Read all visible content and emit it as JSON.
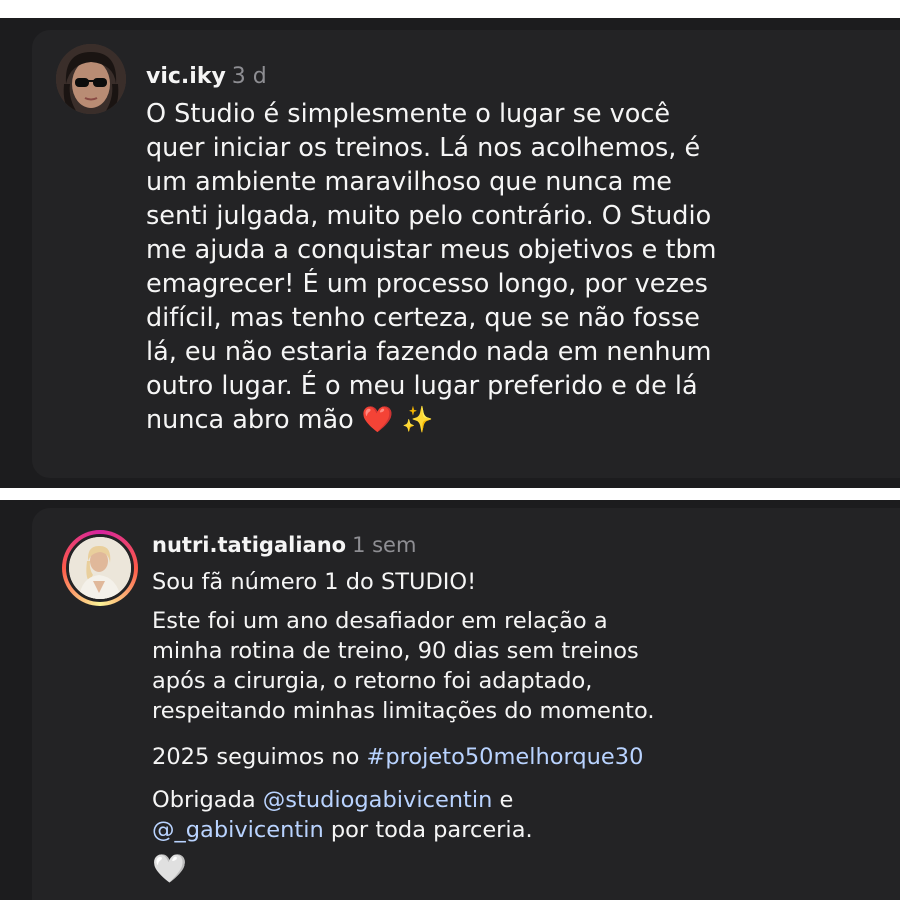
{
  "comment1": {
    "username": "vic.iky",
    "time": "3 d",
    "lines": [
      "O Studio é simplesmente o lugar se você",
      "quer iniciar os treinos. Lá nos acolhemos, é",
      "um ambiente maravilhoso que nunca me",
      "senti julgada, muito pelo contrário. O Studio",
      "me ajuda a conquistar meus objetivos e tbm",
      "emagrecer! É um processo longo, por vezes",
      "difícil, mas tenho certeza, que se não fosse",
      "lá, eu não estaria fazendo nada em nenhum",
      "outro lugar. É o meu lugar preferido e de lá",
      "nunca abro mão"
    ],
    "emoji_heart": "❤️",
    "emoji_sparkles": "✨"
  },
  "comment2": {
    "username": "nutri.tatigaliano",
    "time": "1 sem",
    "p1": "Sou fã número 1 do STUDIO!",
    "p2_lines": [
      "Este foi um ano desafiador em relação a",
      "minha rotina de treino, 90 dias sem treinos",
      "após a cirurgia, o retorno foi adaptado,",
      "respeitando minhas limitações do momento."
    ],
    "p3_text": "2025 seguimos no ",
    "p3_hashtag": "#projeto50melhorque30",
    "p4_line1_text": "Obrigada ",
    "p4_mention1": "@studiogabivicentin",
    "p4_line1_end": " e",
    "p4_mention2": "@_gabivicentin",
    "p4_line2_text": " por toda parceria.",
    "emoji_white_heart": "🤍"
  },
  "colors": {
    "background": "#1c1c1e",
    "card": "#232325",
    "text": "#f5f5f5",
    "muted": "#8e8e93",
    "link": "#b9d3ff"
  }
}
